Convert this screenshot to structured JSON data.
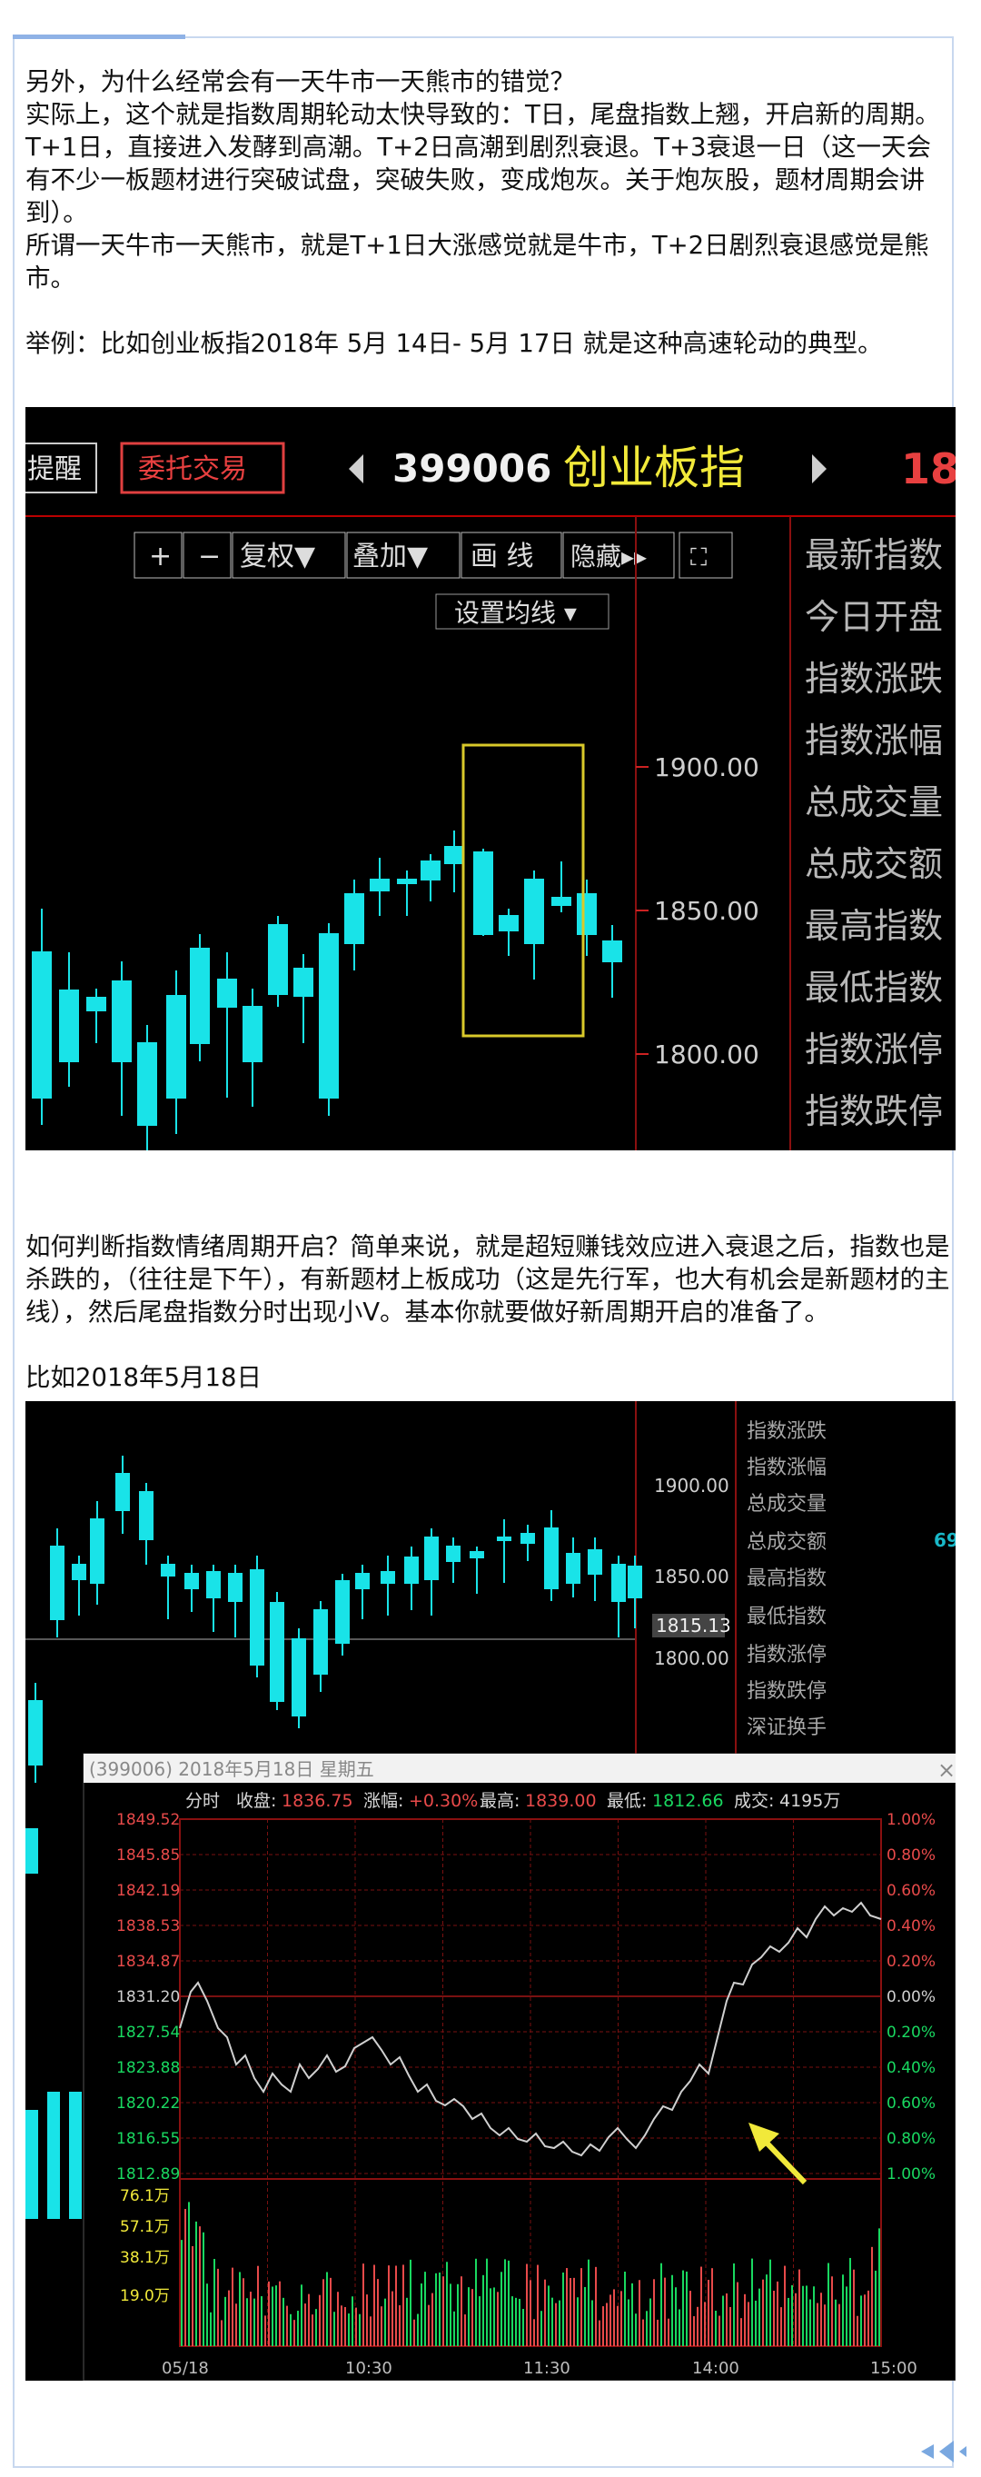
{
  "article": {
    "p1": "另外，为什么经常会有一天牛市一天熊市的错觉？",
    "p2": "实际上，这个就是指数周期轮动太快导致的：T日，尾盘指数上翘，开启新的周期。T+1日，直接进入发酵到高潮。T+2日高潮到剧烈衰退。T+3衰退一日（这一天会有不少一板题材进行突破试盘，突破失败，变成炮灰。关于炮灰股，题材周期会讲到）。",
    "p3": "所谓一天牛市一天熊市，就是T+1日大涨感觉就是牛市，T+2日剧烈衰退感觉是熊市。",
    "p4": "举例：比如创业板指2018年 5月 14日- 5月 17日 就是这种高速轮动的典型。",
    "p5": "如何判断指数情绪周期开启？简单来说，就是超短赚钱效应进入衰退之后，指数也是杀跌的，（往往是下午），有新题材上板成功（这是先行军，也大有机会是新题材的主线），然后尾盘指数分时出现小V。基本你就要做好新周期开启的准备了。",
    "p6": "比如2018年5月18日"
  },
  "shot1": {
    "btn_remind": "提醒",
    "btn_order": "委托交易",
    "code": "399006",
    "name": "创业板指",
    "price_partial": "18",
    "tools": [
      "+",
      "−",
      "复权▼",
      "叠加▼",
      "画 线",
      "隐藏▸▸",
      "⛶"
    ],
    "ma_setting": "设置均线 ▾",
    "price_labels": [
      "1900.00",
      "1850.00",
      "1800.00"
    ],
    "side_labels": [
      "最新指数",
      "今日开盘",
      "指数涨跌",
      "指数涨幅",
      "总成交量",
      "总成交额",
      "最高指数",
      "最低指数",
      "指数涨停",
      "指数跌停"
    ]
  },
  "shot2": {
    "price_labels": [
      "1900.00",
      "1850.00",
      "1815.13",
      "1800.00"
    ],
    "side_labels": [
      "指数涨跌",
      "指数涨幅",
      "总成交量",
      "总成交额",
      "最高指数",
      "最低指数",
      "指数涨停",
      "指数跌停",
      "深证换手"
    ],
    "side_value": "69",
    "popup_title": "(399006) 2018年5月18日 星期五",
    "popup_close": "×",
    "info": {
      "k1": "分时",
      "k2": "收盘:",
      "v2": "1836.75",
      "k3": "涨幅:",
      "v3": "+0.30%",
      "k4": "最高:",
      "v4": "1839.00",
      "k5": "最低:",
      "v5": "1812.66",
      "k6": "成交:",
      "v6": "4195万"
    },
    "left_prices": [
      "1849.52",
      "1845.85",
      "1842.19",
      "1838.53",
      "1834.87",
      "1831.20",
      "1827.54",
      "1823.88",
      "1820.22",
      "1816.55",
      "1812.89"
    ],
    "right_pcts": [
      "1.00%",
      "0.80%",
      "0.60%",
      "0.40%",
      "0.20%",
      "0.00%",
      "0.20%",
      "0.40%",
      "0.60%",
      "0.80%",
      "1.00%"
    ],
    "vol_labels": [
      "76.1万",
      "57.1万",
      "38.1万",
      "19.0万"
    ],
    "time_labels": [
      "05/18",
      "10:30",
      "11:30",
      "14:00",
      "15:00"
    ]
  },
  "colors": {
    "up": "#e84a4a",
    "down": "#19e3e8",
    "yellow": "#f1e93a",
    "grid_red": "#8a1010"
  }
}
